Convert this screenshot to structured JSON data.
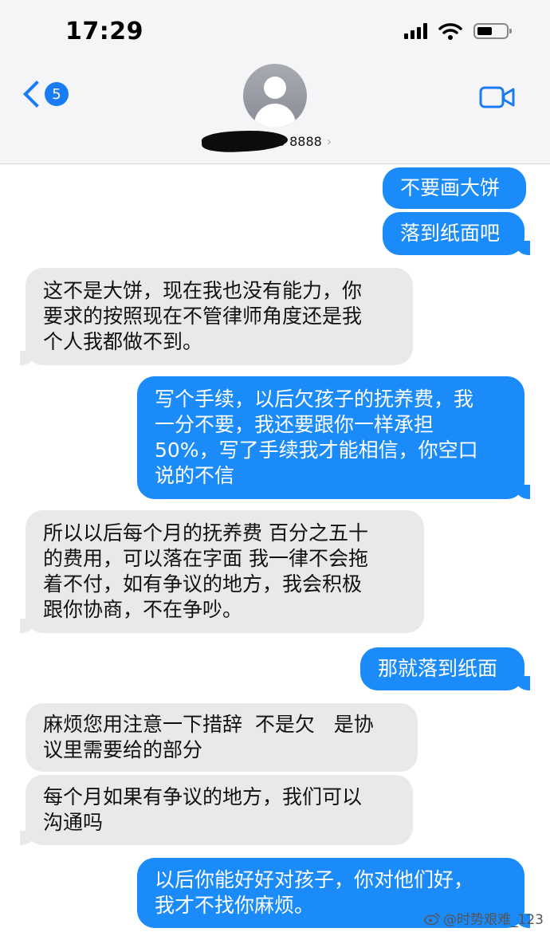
{
  "status_bar": {
    "time": "17:29",
    "icons": [
      "signal-icon",
      "wifi-icon",
      "battery-icon"
    ]
  },
  "header": {
    "back_badge": "5",
    "contact_text": "+86 1··· ···55 8888",
    "icons": [
      "back-chevron-icon",
      "avatar-icon",
      "video-call-icon",
      "chevron-right-icon"
    ]
  },
  "messages": [
    {
      "side": "sent",
      "text": "不要画大饼"
    },
    {
      "side": "sent",
      "text": "落到纸面吧"
    },
    {
      "side": "received",
      "text": "这不是大饼，现在我也没有能力，你\n要求的按照现在不管律师角度还是我\n个人我都做不到。"
    },
    {
      "side": "sent",
      "text": "写个手续，以后欠孩子的抚养费，我\n一分不要，我还要跟你一样承担\n50%，写了手续我才能相信，你空口\n说的不信"
    },
    {
      "side": "received",
      "text": "所以以后每个月的抚养费 百分之五十\n的费用，可以落在字面 我一律不会拖\n着不付，如有争议的地方，我会积极\n跟你协商，不在争吵。"
    },
    {
      "side": "sent",
      "text": "那就落到纸面"
    },
    {
      "side": "received",
      "text": "麻烦您用注意一下措辞  不是欠   是协\n议里需要给的部分"
    },
    {
      "side": "received",
      "text": "每个月如果有争议的地方，我们可以\n沟通吗"
    },
    {
      "side": "sent",
      "text": "以后你能好好对孩子，你对他们好，\n我才不找你麻烦。"
    }
  ],
  "watermark": "@时势艰难_123",
  "colors": {
    "sent_bubble": "#1a8bf8",
    "received_bubble": "#e9e9eb",
    "accent": "#1a7cf5"
  }
}
